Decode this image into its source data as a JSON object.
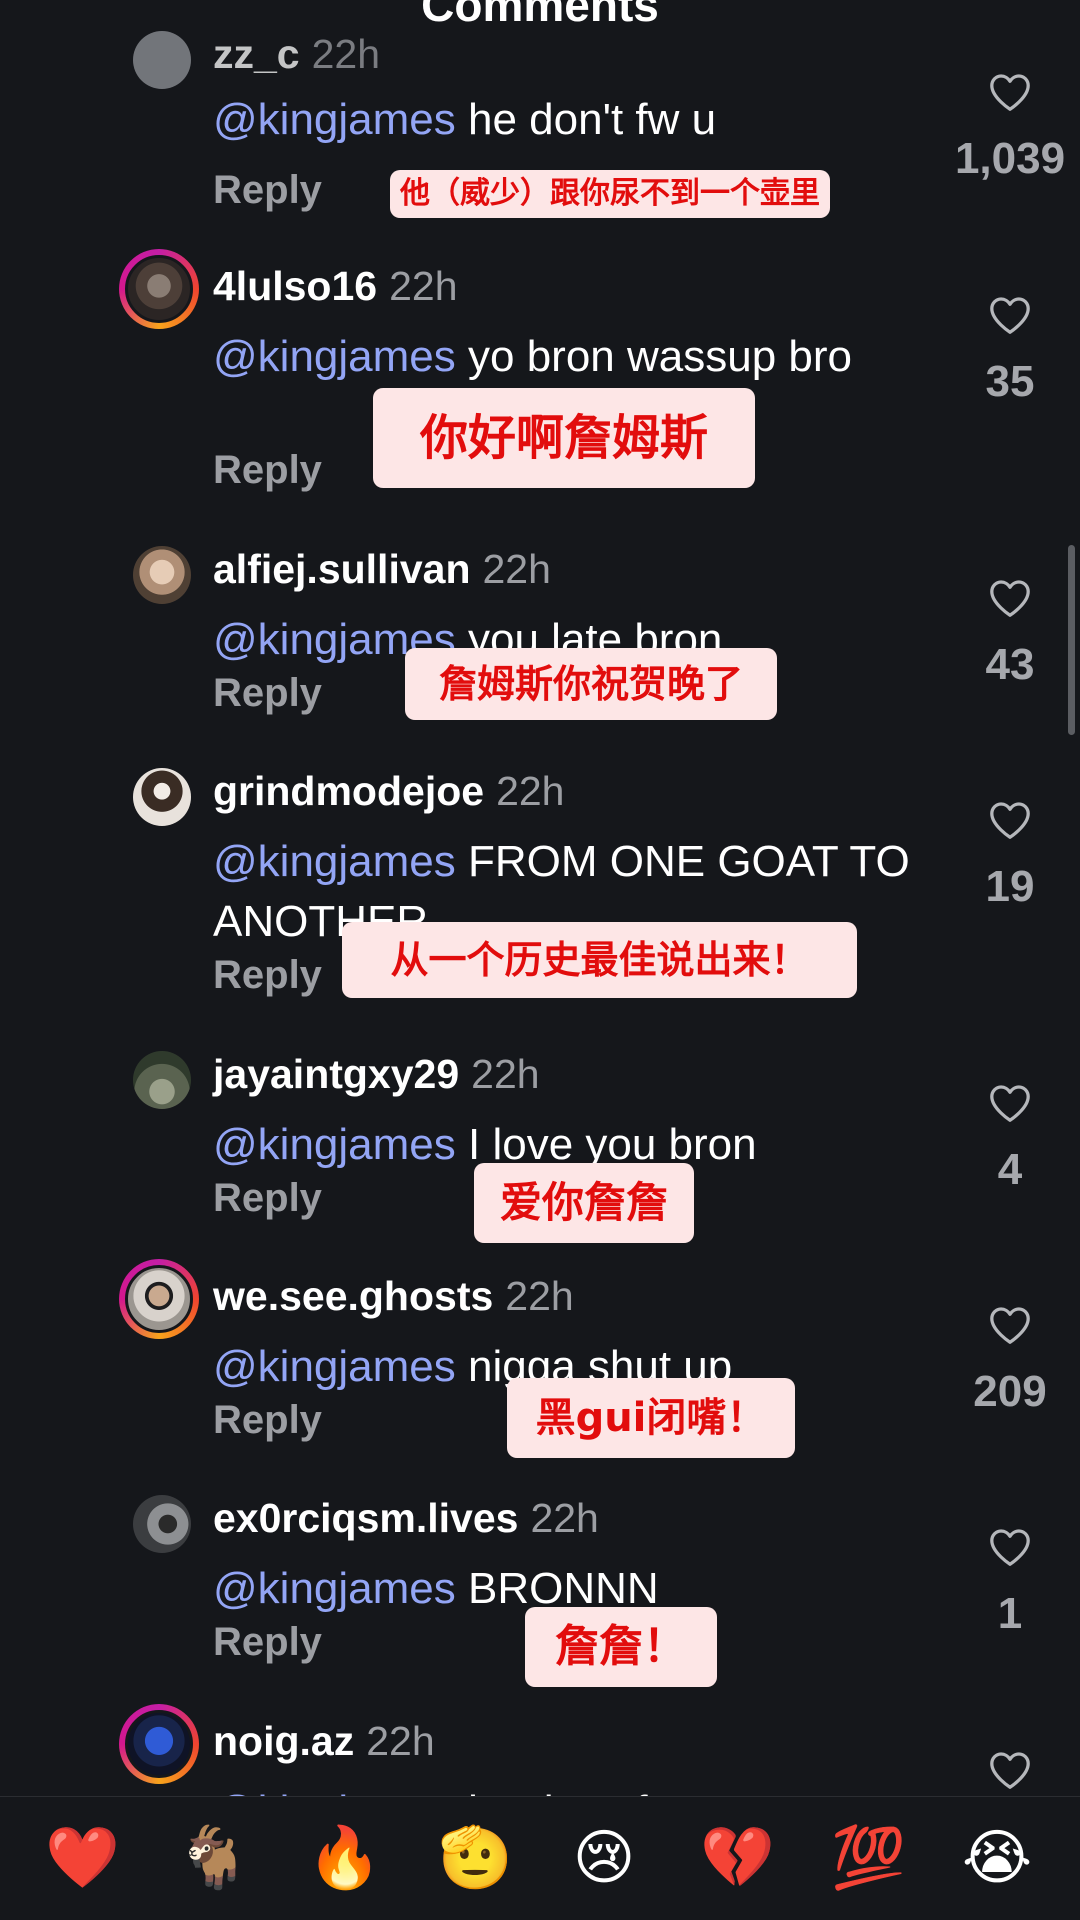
{
  "header": {
    "title": "Comments"
  },
  "reply_label": "Reply",
  "comments": [
    {
      "username": "zz_c",
      "time": "22h",
      "mention": "@kingjames",
      "text": "he don't fw u",
      "likes": "1,039",
      "translation": "他（威少）跟你尿不到一个壶里"
    },
    {
      "username": "4lulso16",
      "time": "22h",
      "mention": "@kingjames",
      "text": "yo bron wassup bro",
      "likes": "35",
      "translation": "你好啊詹姆斯"
    },
    {
      "username": "alfiej.sullivan",
      "time": "22h",
      "mention": "@kingjames",
      "text": "you late bron",
      "likes": "43",
      "translation": "詹姆斯你祝贺晚了"
    },
    {
      "username": "grindmodejoe",
      "time": "22h",
      "mention": "@kingjames",
      "text": "FROM ONE GOAT TO ANOTHER",
      "likes": "19",
      "translation": "从一个历史最佳说出来！"
    },
    {
      "username": "jayaintgxy29",
      "time": "22h",
      "mention": "@kingjames",
      "text": "I love you bron",
      "likes": "4",
      "translation": "爱你詹詹"
    },
    {
      "username": "we.see.ghosts",
      "time": "22h",
      "mention": "@kingjames",
      "text": "nigga shut up",
      "likes": "209",
      "translation": "黑gui闭嘴！"
    },
    {
      "username": "ex0rciqsm.lives",
      "time": "22h",
      "mention": "@kingjames",
      "text": "BRONNN",
      "likes": "1",
      "translation": "詹詹！"
    },
    {
      "username": "noig.az",
      "time": "22h",
      "mention": "@kingjames",
      "text": "he don't fw you",
      "likes": "",
      "translation": ""
    }
  ],
  "emoji_bar": [
    {
      "name": "red-heart-emoji",
      "glyph": "❤️"
    },
    {
      "name": "goat-emoji",
      "glyph": "🐐"
    },
    {
      "name": "fire-emoji",
      "glyph": "🔥"
    },
    {
      "name": "saluting-face-emoji",
      "glyph": "🫡"
    },
    {
      "name": "crying-face-emoji",
      "glyph": "😢"
    },
    {
      "name": "broken-heart-emoji",
      "glyph": "💔"
    },
    {
      "name": "hundred-points-emoji",
      "glyph": "💯"
    },
    {
      "name": "loudly-crying-face-emoji",
      "glyph": "😭"
    }
  ]
}
